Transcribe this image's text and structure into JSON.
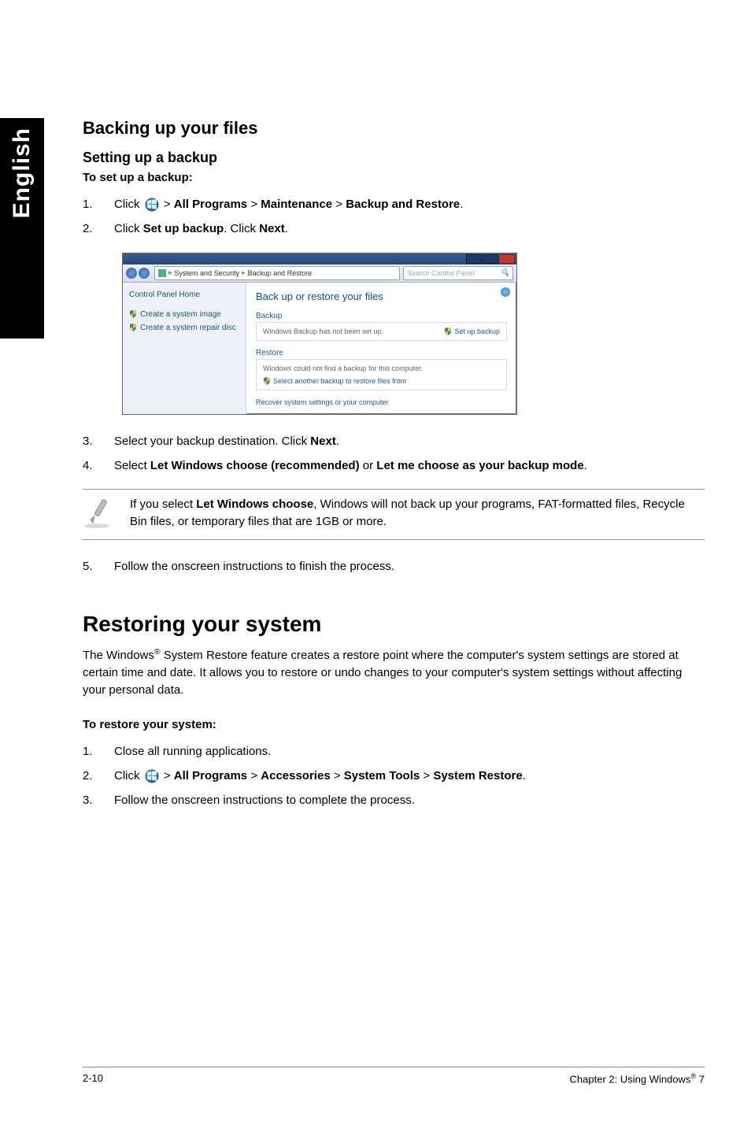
{
  "side_tab": "English",
  "h_backing": "Backing up your files",
  "h_setting": "Setting up a backup",
  "lead_setup": "To set up a backup:",
  "step1_a": "Click ",
  "step1_b": " > ",
  "step1_all": "All Programs",
  "step1_maint": "Maintenance",
  "step1_bar": "Backup and Restore",
  "step1_end": ".",
  "step2_a": "Click ",
  "step2_set": "Set up backup",
  "step2_b": ". Click ",
  "step2_next": "Next",
  "step2_end": ".",
  "shot": {
    "crumb_icon_label": "▸",
    "crumb1": "System and Security",
    "crumb2": "Backup and Restore",
    "search_placeholder": "Search Control Panel",
    "side_home": "Control Panel Home",
    "side_link1": "Create a system image",
    "side_link2": "Create a system repair disc",
    "main_header": "Back up or restore your files",
    "grp_backup": "Backup",
    "backup_msg": "Windows Backup has not been set up.",
    "setup_link": "Set up backup",
    "grp_restore": "Restore",
    "restore_msg": "Windows could not find a backup for this computer.",
    "restore_link": "Select another backup to restore files from",
    "recover_link": "Recover system settings or your computer"
  },
  "step3_a": "Select your backup destination. Click ",
  "step3_next": "Next",
  "step3_end": ".",
  "step4_a": "Select ",
  "step4_b": "Let Windows choose (recommended)",
  "step4_c": " or ",
  "step4_d": "Let me choose as your backup mode",
  "step4_end": ".",
  "note_a": "If you select ",
  "note_b": "Let Windows choose",
  "note_c": ", Windows will not back up your programs, FAT-formatted files, Recycle Bin files, or temporary files that are 1GB or more.",
  "step5": "Follow the onscreen instructions to finish the process.",
  "h_restoring": "Restoring your system",
  "restore_para_a": "The Windows",
  "restore_para_b": " System Restore feature creates a restore point where the computer's system settings are stored at certain time and date. It allows you to restore or undo changes to your computer's system settings without affecting your personal data.",
  "lead_restore": "To restore your system:",
  "r1": "Close all running applications.",
  "r2_a": "Click ",
  "r2_b": " > ",
  "r2_all": "All Programs",
  "r2_acc": "Accessories",
  "r2_sys": "System Tools",
  "r2_sr": "System Restore",
  "r2_end": ".",
  "r3": "Follow the onscreen instructions to complete the process.",
  "footer_left": "2-10",
  "footer_right_a": "Chapter 2: Using Windows",
  "footer_right_b": " 7"
}
